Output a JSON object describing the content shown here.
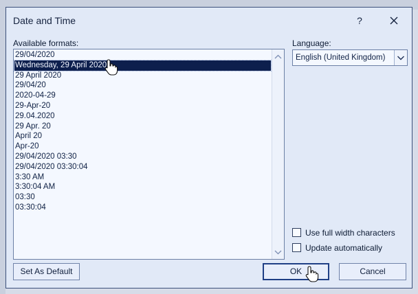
{
  "window": {
    "title": "Date and Time",
    "help_label": "?"
  },
  "formats": {
    "label": "Available formats:",
    "selected_index": 1,
    "items": [
      "29/04/2020",
      "Wednesday, 29 April 2020",
      "29 April 2020",
      "29/04/20",
      "2020-04-29",
      "29-Apr-20",
      "29.04.2020",
      "29 Apr. 20",
      "April 20",
      "Apr-20",
      "29/04/2020 03:30",
      "29/04/2020 03:30:04",
      "3:30 AM",
      "3:30:04 AM",
      "03:30",
      "03:30:04"
    ]
  },
  "language": {
    "label": "Language:",
    "value": "English (United Kingdom)"
  },
  "options": {
    "full_width_label": "Use full width characters",
    "full_width_checked": false,
    "update_auto_label": "Update automatically",
    "update_auto_checked": false
  },
  "buttons": {
    "set_default": "Set As Default",
    "ok": "OK",
    "cancel": "Cancel"
  },
  "icons": {
    "close": "close-icon",
    "scroll_up": "chevron-up-icon",
    "scroll_down": "chevron-down-icon",
    "dropdown": "chevron-down-icon",
    "cursor": "hand-pointer-icon"
  }
}
